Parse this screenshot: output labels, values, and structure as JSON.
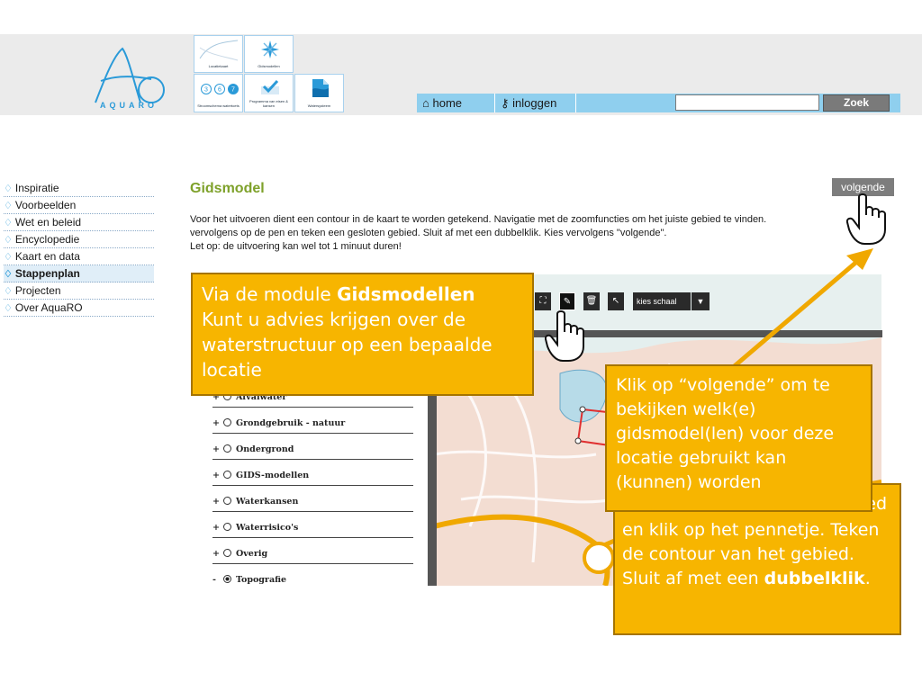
{
  "header": {
    "logo_text": "AQUARO",
    "tiles": [
      {
        "label": "Locatiekaart",
        "icon": "map-thumbnail-icon"
      },
      {
        "label": "Gidsmodellen",
        "icon": "compass-star-icon"
      },
      {
        "label": "Stroomschema watertoets",
        "icon": "flow-steps-icon",
        "steps": [
          "3",
          "6",
          "7"
        ]
      },
      {
        "label": "Programma van eisen & kansen",
        "icon": "checkmark-icon"
      },
      {
        "label": "Watersysteem",
        "icon": "water-document-icon"
      }
    ],
    "nav": {
      "home": "home",
      "login": "inloggen"
    },
    "search": {
      "value": "",
      "button": "Zoek"
    }
  },
  "sidebar": {
    "items": [
      {
        "label": "Inspiratie",
        "active": false
      },
      {
        "label": "Voorbeelden",
        "active": false
      },
      {
        "label": "Wet en beleid",
        "active": false
      },
      {
        "label": "Encyclopedie",
        "active": false
      },
      {
        "label": "Kaart en data",
        "active": false
      },
      {
        "label": "Stappenplan",
        "active": true
      },
      {
        "label": "Projecten",
        "active": false
      },
      {
        "label": "Over AquaRO",
        "active": false
      }
    ]
  },
  "main": {
    "title": "Gidsmodel",
    "next_button": "volgende",
    "intro_lines": [
      "Voor het uitvoeren dient een contour in de kaart te worden getekend. Navigatie met de zoomfuncties om het juiste gebied te vinden.",
      "vervolgens op de pen en teken een gesloten gebied. Sluit af met een dubbelklik. Kies vervolgens \"volgende\".",
      "Let op: de uitvoering kan wel tot 1 minuut duren!"
    ],
    "map_toolbar": {
      "scale_label": "kies schaal"
    },
    "layers": [
      {
        "label": "Afvalwater",
        "toggle": "+",
        "checked": false
      },
      {
        "label": "Grondgebruik - natuur",
        "toggle": "+",
        "checked": false
      },
      {
        "label": "Ondergrond",
        "toggle": "+",
        "checked": false
      },
      {
        "label": "GIDS-modellen",
        "toggle": "+",
        "checked": false
      },
      {
        "label": "Waterkansen",
        "toggle": "+",
        "checked": false
      },
      {
        "label": "Waterrisico's",
        "toggle": "+",
        "checked": false
      },
      {
        "label": "Overig",
        "toggle": "+",
        "checked": false
      },
      {
        "label": "Topografie",
        "toggle": "-",
        "checked": true
      }
    ]
  },
  "callouts": {
    "module": {
      "line1_prefix": "Via de module ",
      "line1_bold": "Gidsmodellen",
      "rest": "Kunt u advies krijgen over de waterstructuur op een bepaalde locatie"
    },
    "next": {
      "text": "Klik op “volgende”  om te bekijken welk(e) gidsmodel(len) voor deze locatie gebruikt kan (kunnen) worden"
    },
    "draw": {
      "peek": "ed",
      "text": "en klik op het pennetje. Teken de contour van het gebied. Sluit af met een ",
      "bold": "dubbelklik",
      "end": "."
    }
  },
  "colors": {
    "callout": "#f7b500",
    "title_green": "#7ea12a",
    "nav_blue": "#8fcfee",
    "accent_arrow": "#f0a800"
  }
}
